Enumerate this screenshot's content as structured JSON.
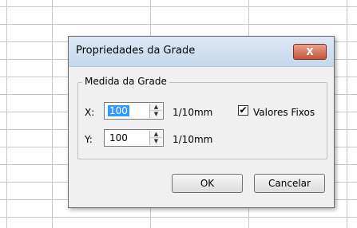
{
  "dialog": {
    "title": "Propriedades da Grade",
    "close_label": "X",
    "group_label": "Medida da Grade",
    "x_label": "X:",
    "x_value": "100",
    "y_label": "Y:",
    "y_value": "100",
    "unit_label": "1/10mm",
    "checkbox_label": "Valores Fixos",
    "checkbox_checked": true,
    "checkbox_mark": "✔",
    "ok_label": "OK",
    "cancel_label": "Cancelar"
  },
  "colors": {
    "selection": "#3399ff",
    "close_button": "#c65237"
  },
  "icons": {
    "spin_up": "▲",
    "spin_down": "▼"
  }
}
